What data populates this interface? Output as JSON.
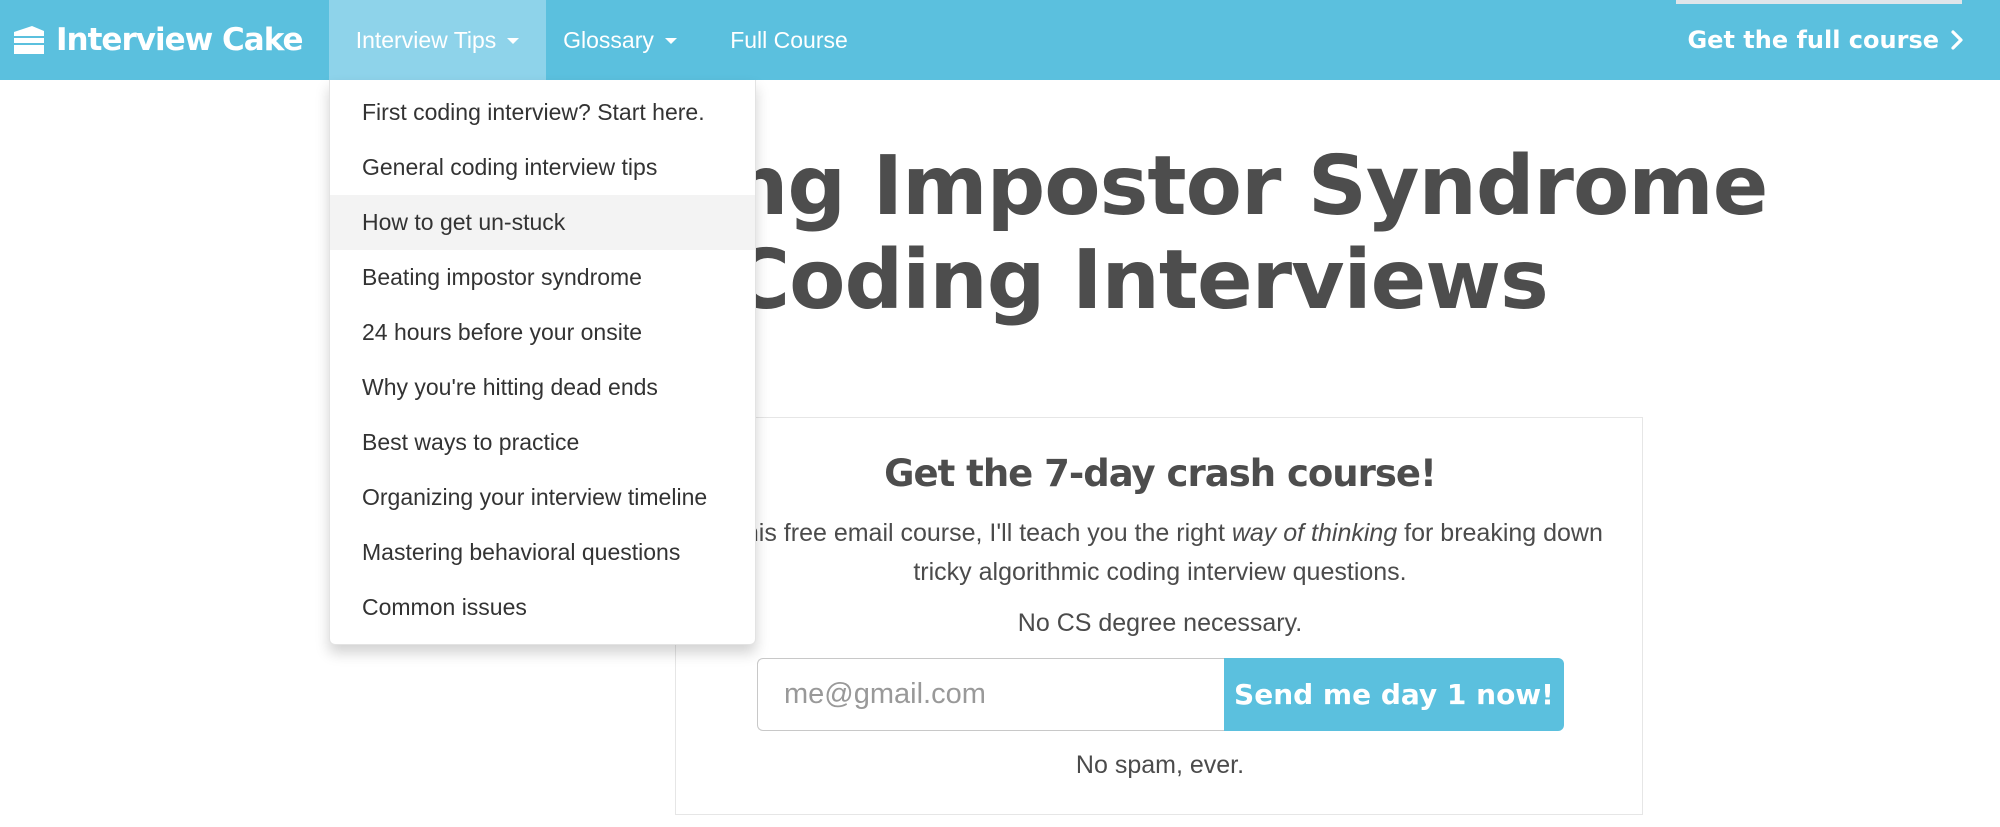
{
  "navbar": {
    "brand": "Interview Cake",
    "tips": "Interview Tips",
    "glossary": "Glossary",
    "full_course": "Full Course",
    "cta": "Get the full course",
    "bg_color": "#5bc0de",
    "active_bg_color": "#8ed3ea",
    "icons": {
      "brand": "cake-icon",
      "caret": "caret-down-icon",
      "cta": "chevron-right-icon"
    }
  },
  "headline": {
    "line1": "ng Impostor Syndrome",
    "line2": "Coding Interviews"
  },
  "dropdown": {
    "items": [
      "First coding interview? Start here.",
      "General coding interview tips",
      "How to get un-stuck",
      "Beating impostor syndrome",
      "24 hours before your onsite",
      "Why you're hitting dead ends",
      "Best ways to practice",
      "Organizing your interview timeline",
      "Mastering behavioral questions",
      "Common issues"
    ],
    "hovered": "How to get un-stuck"
  },
  "signup": {
    "title": "Get the 7-day crash course!",
    "desc_before": "n this free email course, I'll teach you the right ",
    "desc_em": "way of thinking",
    "desc_after": " for breaking down tricky algorithmic coding interview questions.",
    "note": "No CS degree necessary.",
    "email_placeholder": "me@gmail.com",
    "email_value": "",
    "button": "Send me day 1 now!",
    "spam": "No spam, ever."
  }
}
